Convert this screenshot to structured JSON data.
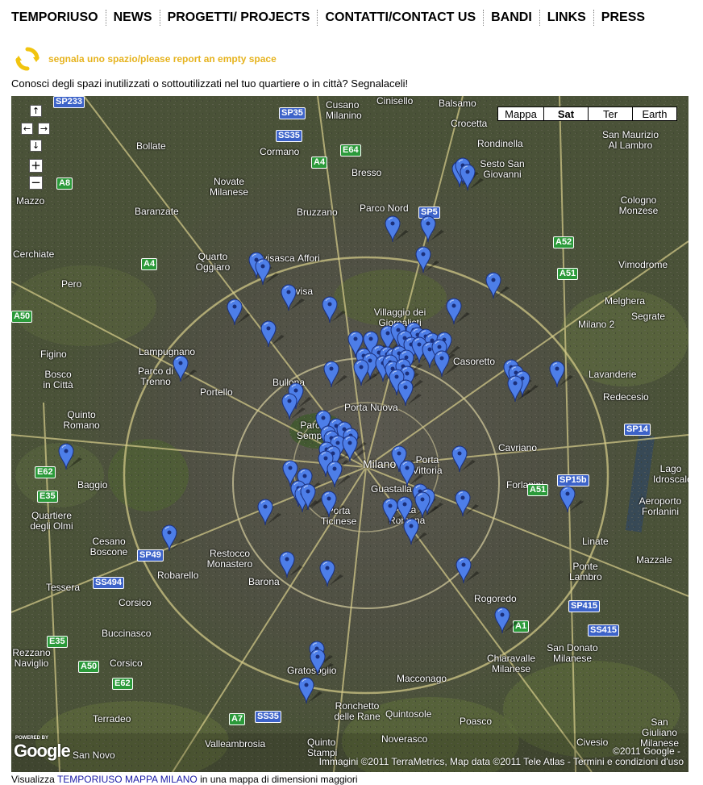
{
  "nav": {
    "items": [
      "TEMPORIUSO",
      "NEWS",
      "PROGETTI/ PROJECTS",
      "CONTATTI/CONTACT US",
      "BANDI",
      "LINKS",
      "PRESS"
    ]
  },
  "report": {
    "icon": "recycle-arrows-icon",
    "link_text": "segnala uno spazio/please report an empty space",
    "accent_color": "#e6b31e"
  },
  "intro_text": "Conosci degli spazi inutilizzati o sottoutilizzati nel tuo quartiere o in città? Segnalaceli!",
  "map": {
    "type_buttons": [
      "Mappa",
      "Sat",
      "Ter",
      "Earth"
    ],
    "active_type": "Sat",
    "controls": {
      "pan_up": "↑",
      "pan_left": "←",
      "pan_right": "→",
      "pan_down": "↓",
      "zoom_in": "+",
      "zoom_out": "−"
    },
    "pin_color": "#4d7ee8",
    "place_labels": [
      "Balsamo",
      "Cusano Milanino",
      "Cinisello",
      "Crocetta",
      "Rondinella",
      "Sesto San Giovanni",
      "San Maurizio Al Lambro",
      "Bollate",
      "Cormano",
      "Bresso",
      "Novate Milanese",
      "Mazzo",
      "Baranzate",
      "Bruzzano",
      "Parco Nord",
      "Cologno Monzese",
      "Cerchiate",
      "Quarto Oggiaro",
      "Bovisasca",
      "Affori",
      "Vimodrome",
      "Pero",
      "Bovisa",
      "Villaggio dei Giornalisti",
      "Melghera",
      "Segrate",
      "Milano 2",
      "Figino",
      "Lampugnano",
      "Casoretto",
      "Lavanderie",
      "Bosco in Città",
      "Parco di Trenno",
      "Bullona",
      "Portello",
      "Redecesio",
      "Quinto Romano",
      "Porta Nuova",
      "Parco Sempione",
      "Cavriano",
      "Milano",
      "Porta Vittoria",
      "Forlanini",
      "Lago Idroscalo",
      "Baggio",
      "Guastalla",
      "Aeroporto Forlanini",
      "Quartiere degli Olmi",
      "Porta Romana",
      "Porta Ticinese",
      "Cesano Boscone",
      "Linate",
      "Restocco Monastero",
      "Robarello",
      "Mazzale",
      "Ponte Lambro",
      "Tessera",
      "Corsico",
      "Barona",
      "Rogoredo",
      "Buccinasco",
      "Chiaravalle Milanese",
      "San Donato Milanese",
      "Rezzano Naviglio",
      "Corsico",
      "Gratosoglio",
      "Macconago",
      "Ronchetto delle Rane",
      "Quintosole",
      "Terradeo",
      "Poasco",
      "San Giuliano Milanese",
      "Valleambrosia",
      "Quinto Stampi",
      "Noverasco",
      "Civesio",
      "San Novo"
    ],
    "road_shields": [
      "SP233",
      "SP35",
      "SS35",
      "E64",
      "A4",
      "A8",
      "SP5",
      "A52",
      "A51",
      "A4",
      "A50",
      "SP14",
      "E62",
      "E35",
      "SP15b",
      "A51",
      "SP49",
      "SS494",
      "SP415",
      "A1",
      "SS415",
      "E35",
      "A50",
      "E62",
      "A7",
      "SS35"
    ],
    "logo_small": "POWERED BY",
    "logo_text": "Google",
    "copyright": "©2011 Google -",
    "attribution": "Immagini ©2011 TerraMetrics, Map data ©2011 Tele Atlas - Termini e condizioni d'uso"
  },
  "bottom": {
    "prefix": "Visualizza",
    "link": "TEMPORIUSO MAPPA MILANO",
    "suffix": "in una mappa di dimensioni maggiori"
  }
}
